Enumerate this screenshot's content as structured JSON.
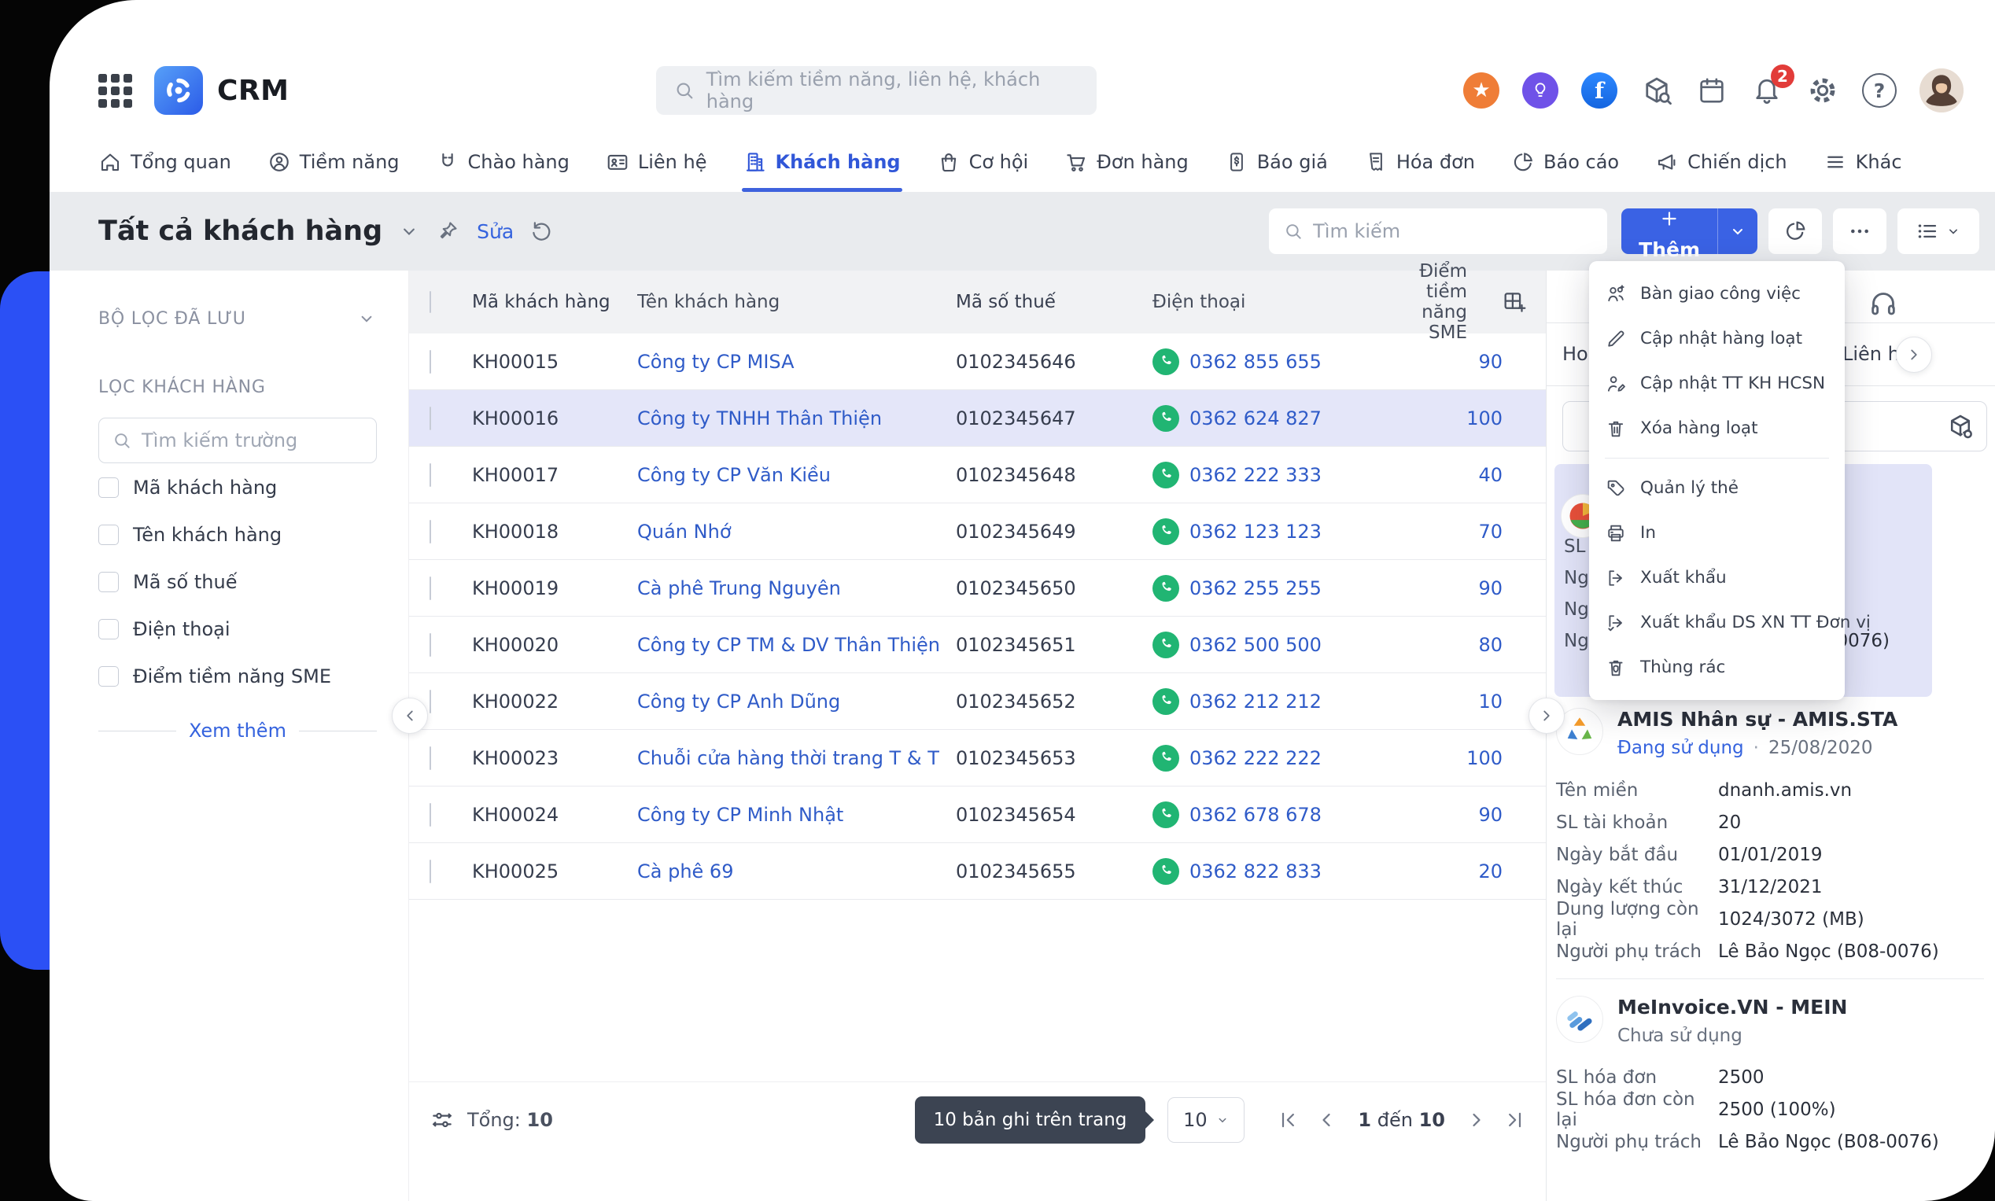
{
  "header": {
    "app_name": "CRM",
    "search_placeholder": "Tìm kiếm tiềm năng, liên hệ, khách hàng",
    "notification_count": "2",
    "facebook_letter": "f",
    "help_glyph": "?"
  },
  "nav": {
    "items": [
      {
        "label": "Tổng quan"
      },
      {
        "label": "Tiềm năng"
      },
      {
        "label": "Chào hàng"
      },
      {
        "label": "Liên hệ"
      },
      {
        "label": "Khách hàng"
      },
      {
        "label": "Cơ hội"
      },
      {
        "label": "Đơn hàng"
      },
      {
        "label": "Báo giá"
      },
      {
        "label": "Hóa đơn"
      },
      {
        "label": "Báo cáo"
      },
      {
        "label": "Chiến dịch"
      },
      {
        "label": "Khác"
      }
    ],
    "active": "Khách hàng"
  },
  "toolbar": {
    "title": "Tất cả khách hàng",
    "edit_label": "Sửa",
    "search_placeholder": "Tìm kiếm",
    "add_label": "Thêm"
  },
  "sidebar": {
    "saved_filters_label": "BỘ LỌC ĐÃ LƯU",
    "filter_section_label": "LỌC KHÁCH HÀNG",
    "field_search_placeholder": "Tìm kiếm trường",
    "filters": [
      {
        "label": "Mã khách hàng"
      },
      {
        "label": "Tên khách hàng"
      },
      {
        "label": "Mã số thuế"
      },
      {
        "label": "Điện thoại"
      },
      {
        "label": "Điểm tiềm năng SME"
      }
    ],
    "see_more_label": "Xem thêm"
  },
  "table": {
    "columns": {
      "code": "Mã khách hàng",
      "name": "Tên khách hàng",
      "tax": "Mã số thuế",
      "phone": "Điện thoại",
      "score": "Điểm tiềm năng SME"
    },
    "rows": [
      {
        "code": "KH00015",
        "name": "Công ty CP MISA",
        "tax": "0102345646",
        "phone": "0362 855 655",
        "score": "90"
      },
      {
        "code": "KH00016",
        "name": "Công ty TNHH Thân Thiện",
        "tax": "0102345647",
        "phone": "0362 624 827",
        "score": "100"
      },
      {
        "code": "KH00017",
        "name": "Công ty CP Văn Kiều",
        "tax": "0102345648",
        "phone": "0362 222 333",
        "score": "40"
      },
      {
        "code": "KH00018",
        "name": "Quán Nhớ",
        "tax": "0102345649",
        "phone": "0362 123 123",
        "score": "70"
      },
      {
        "code": "KH00019",
        "name": "Cà phê Trung Nguyên",
        "tax": "0102345650",
        "phone": "0362 255 255",
        "score": "90"
      },
      {
        "code": "KH00020",
        "name": "Công ty CP TM & DV Thân Thiện",
        "tax": "0102345651",
        "phone": "0362 500 500",
        "score": "80"
      },
      {
        "code": "KH00022",
        "name": "Công ty CP Anh Dũng",
        "tax": "0102345652",
        "phone": "0362 212 212",
        "score": "10"
      },
      {
        "code": "KH00023",
        "name": "Chuỗi cửa hàng thời trang T & T",
        "tax": "0102345653",
        "phone": "0362 222 222",
        "score": "100"
      },
      {
        "code": "KH00024",
        "name": "Công ty CP Minh Nhật",
        "tax": "0102345654",
        "phone": "0362 678 678",
        "score": "90"
      },
      {
        "code": "KH00025",
        "name": "Cà phê 69",
        "tax": "0102345655",
        "phone": "0362 822 833",
        "score": "20"
      }
    ]
  },
  "footer": {
    "total_label": "Tổng:",
    "total_value": "10",
    "tooltip": "10 bản ghi trên trang",
    "page_size": "10",
    "range_start": "1",
    "range_mid": "đến",
    "range_end": "10"
  },
  "context_menu": {
    "items": [
      {
        "label": "Bàn giao công việc"
      },
      {
        "label": "Cập nhật hàng loạt"
      },
      {
        "label": "Cập nhật TT KH HCSN"
      },
      {
        "label": "Xóa hàng loạt"
      },
      {
        "label": "Quản lý thẻ"
      },
      {
        "label": "In"
      },
      {
        "label": "Xuất khẩu"
      },
      {
        "label": "Xuất khẩu DS XN TT Đơn vị"
      },
      {
        "label": "Thùng rác"
      }
    ]
  },
  "right_panel": {
    "tab_left_fragment": "Hoa",
    "contacts_tab": "Liên hệ",
    "selected_card": {
      "row_fragments": [
        "SL",
        "Ng",
        "Ng",
        "Ng"
      ],
      "value_tail": "-0076)"
    },
    "products": [
      {
        "name": "AMIS Nhân sự - AMIS.STA",
        "status": "Đang sử dụng",
        "status_dot": "·",
        "status_date": "25/08/2020",
        "fields": [
          {
            "label": "Tên miền",
            "value": "dnanh.amis.vn"
          },
          {
            "label": "SL tài khoản",
            "value": "20"
          },
          {
            "label": "Ngày bắt đầu",
            "value": "01/01/2019"
          },
          {
            "label": "Ngày kết thúc",
            "value": "31/12/2021"
          },
          {
            "label": "Dung lượng còn lại",
            "value": "1024/3072 (MB)"
          },
          {
            "label": "Người phụ trách",
            "value": "Lê Bảo Ngọc (B08-0076)"
          }
        ]
      },
      {
        "name": "MeInvoice.VN - MEIN",
        "status": "Chưa sử dụng",
        "fields": [
          {
            "label": "SL hóa đơn",
            "value": "2500"
          },
          {
            "label": "SL hóa đơn còn lại",
            "value": "2500 (100%)"
          },
          {
            "label": "Người phụ trách",
            "value": "Lê Bảo Ngọc (B08-0076)"
          }
        ]
      }
    ]
  },
  "colors": {
    "accent_bar": "#2B50F5",
    "primary_button": "#3A62E4",
    "link": "#2F5BC8",
    "phone_green": "#21B573",
    "selected_row": "#E4E6F9",
    "badge_red": "#E23C39"
  }
}
